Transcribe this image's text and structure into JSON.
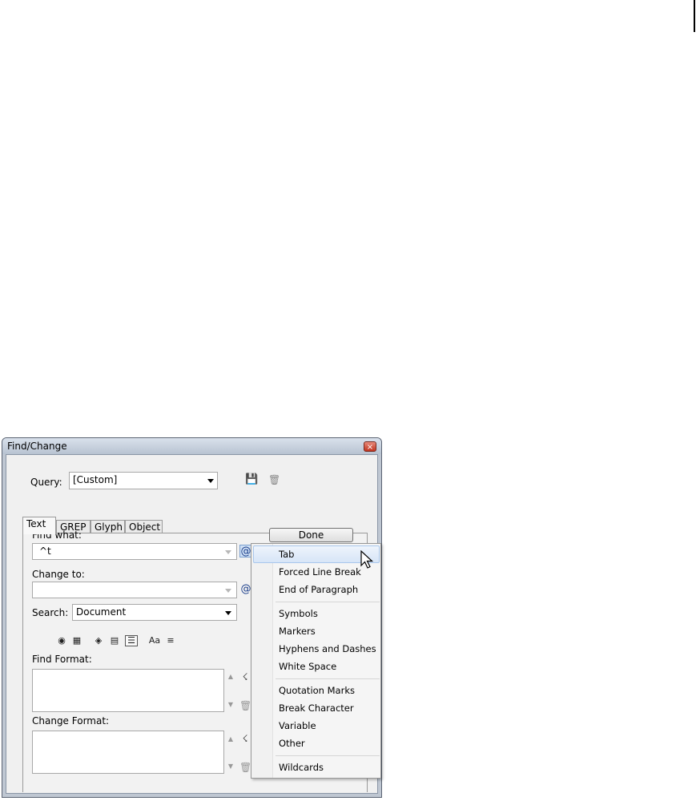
{
  "dialog": {
    "title": "Find/Change",
    "close_glyph": "×",
    "query": {
      "label": "Query:",
      "value": "[Custom]"
    },
    "tabs": [
      "Text",
      "GREP",
      "Glyph",
      "Object"
    ],
    "find_what": {
      "label": "Find what:",
      "value": "^t"
    },
    "change_to": {
      "label": "Change to:",
      "value": ""
    },
    "search": {
      "label": "Search:",
      "value": "Document"
    },
    "find_format": {
      "label": "Find Format:"
    },
    "change_format": {
      "label": "Change Format:"
    },
    "done_label": "Done",
    "special_char_glyph": "@",
    "case_sensitive_label": "Aa"
  },
  "menu": {
    "items": [
      "Tab",
      "Forced Line Break",
      "End of Paragraph",
      "Symbols",
      "Markers",
      "Hyphens and Dashes",
      "White Space",
      "Quotation Marks",
      "Break Character",
      "Variable",
      "Other",
      "Wildcards"
    ],
    "highlighted": "Tab"
  },
  "colors": {
    "menu_highlight": "#d7e5f7",
    "close_button": "#c1341f",
    "special_icon": "#1a3d8a"
  }
}
